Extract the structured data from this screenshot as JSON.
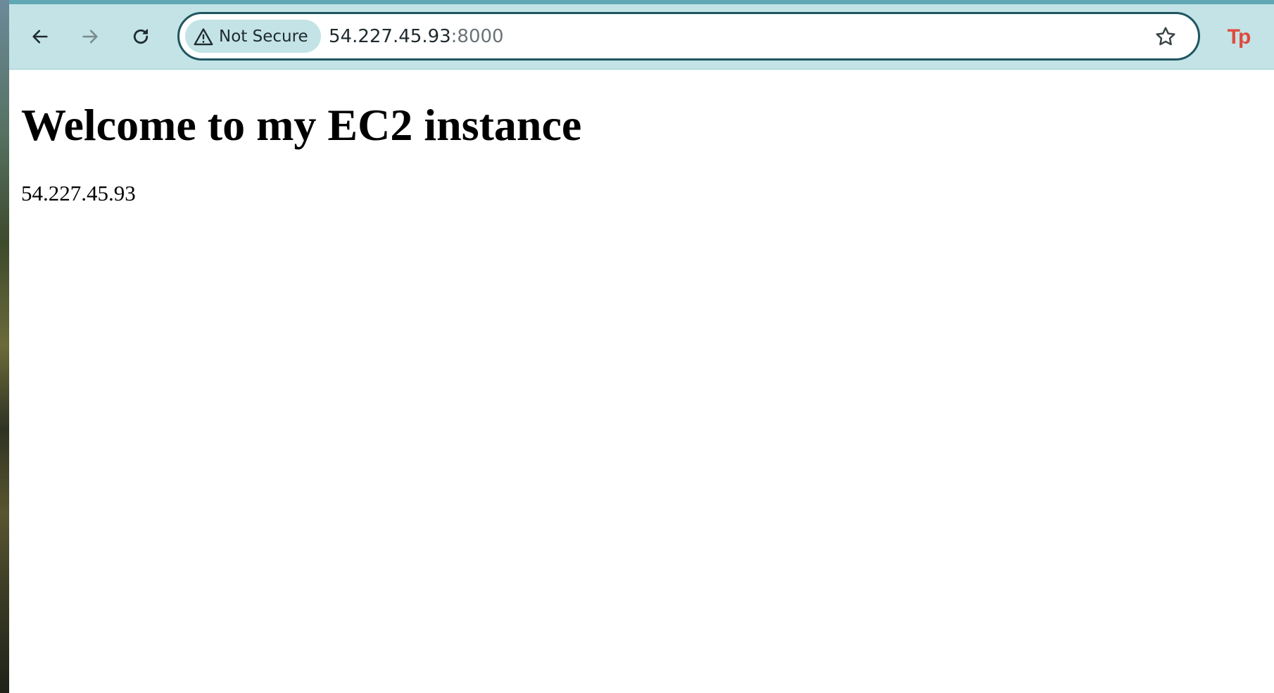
{
  "browser": {
    "security_label": "Not Secure",
    "url_host": "54.227.45.93",
    "url_port": ":8000",
    "extension_label": "Tp",
    "icons": {
      "back": "arrow-left-icon",
      "forward": "arrow-right-icon",
      "reload": "reload-icon",
      "security": "warning-triangle-icon",
      "bookmark": "star-outline-icon",
      "extension": "tp-extension-icon"
    },
    "colors": {
      "toolbar": "#c3e3e6",
      "omnibox_border": "#1f5560",
      "extension": "#e04a3f"
    }
  },
  "page": {
    "heading": "Welcome to my EC2 instance",
    "ip_text": "54.227.45.93"
  }
}
